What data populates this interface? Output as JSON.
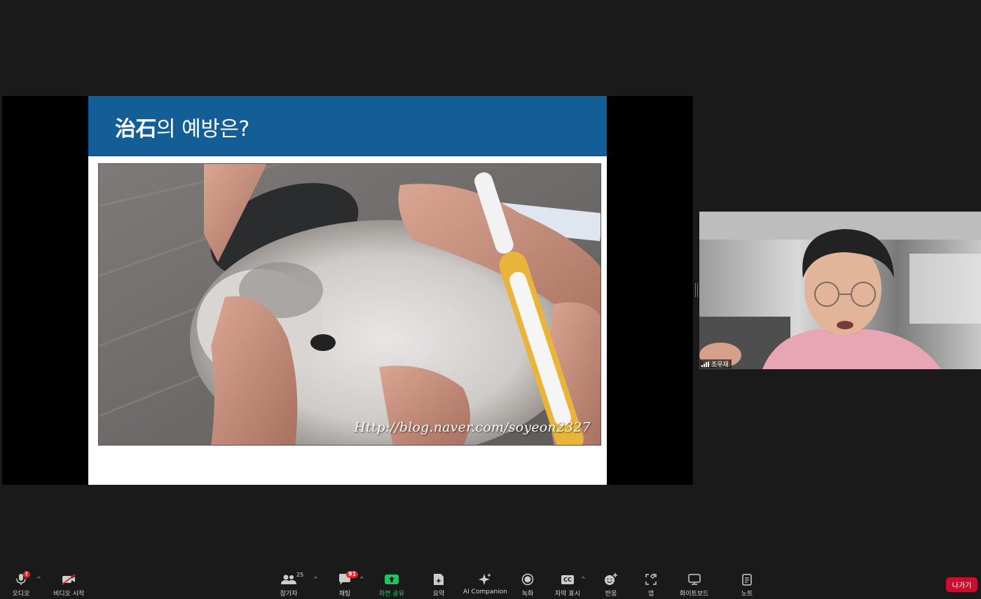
{
  "slide": {
    "title_bold": "治石",
    "title_rest": "의 예방은?",
    "watermark": "Http://blog.naver.com/soyeon2327"
  },
  "participant": {
    "name": "조우재"
  },
  "toolbar": {
    "audio_label": "오디오",
    "video_label": "비디오 시작",
    "participants_label": "참가자",
    "participants_count": "25",
    "chat_label": "채팅",
    "chat_badge": "91",
    "share_label": "화면 공유",
    "summary_label": "요약",
    "ai_label": "AI Companion",
    "record_label": "녹화",
    "captions_label": "자막 표시",
    "captions_icon_text": "CC",
    "reactions_label": "반응",
    "apps_label": "앱",
    "whiteboard_label": "화이트보드",
    "notes_label": "노트",
    "leave_label": "나가기",
    "audio_alert": "!"
  },
  "colors": {
    "slide_header": "#135e96",
    "share_green": "#22c35e",
    "leave_red": "#c8102e",
    "badge_red": "#e02828"
  },
  "icons": {
    "audio": "microphone-icon",
    "video": "video-camera-off-icon",
    "participants": "people-icon",
    "chat": "chat-bubble-icon",
    "share": "share-screen-icon",
    "summary": "document-sparkle-icon",
    "ai": "sparkle-icon",
    "record": "record-icon",
    "captions": "cc-icon",
    "reactions": "emoji-plus-icon",
    "apps": "apps-icon",
    "whiteboard": "whiteboard-icon",
    "notes": "notes-icon"
  }
}
